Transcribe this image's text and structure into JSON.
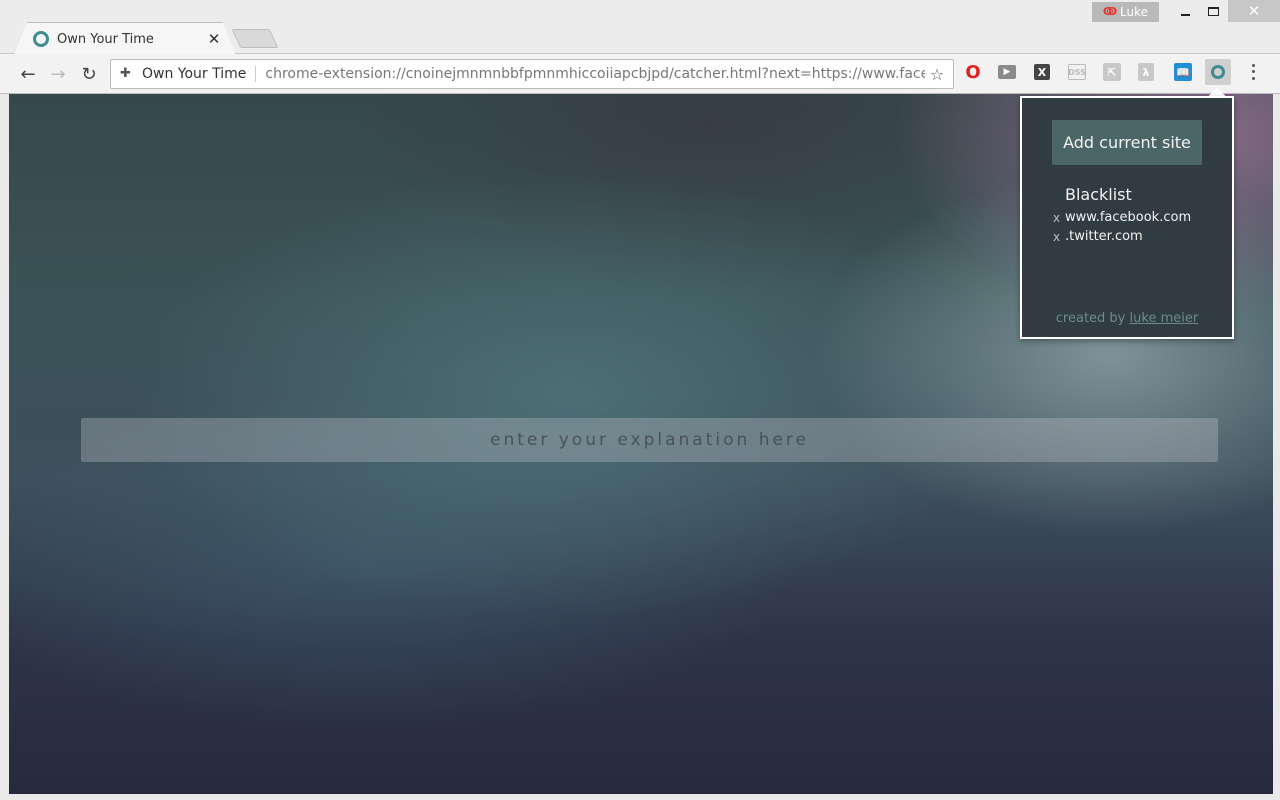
{
  "window": {
    "profile_name": "Luke",
    "close_glyph": "✕"
  },
  "tab": {
    "title": "Own Your Time",
    "close_glyph": "✕"
  },
  "toolbar": {
    "back_glyph": "←",
    "forward_glyph": "→",
    "reload_glyph": "↻",
    "origin_label": "Own Your Time",
    "url": "chrome-extension://cnoinejmnmnbbfpmnmhiccoiiapcbjpd/catcher.html?next=https://www.facebo",
    "star_glyph": "☆"
  },
  "extensions": [
    {
      "name": "opera-icon",
      "glyph": "O"
    },
    {
      "name": "video-icon",
      "glyph": "▶"
    },
    {
      "name": "x-icon",
      "glyph": "X"
    },
    {
      "name": "dss-icon",
      "glyph": "DSS"
    },
    {
      "name": "share-icon",
      "glyph": "⇱"
    },
    {
      "name": "pdf-icon",
      "glyph": "λ"
    },
    {
      "name": "book-icon",
      "glyph": "📖"
    },
    {
      "name": "own-your-time-icon",
      "glyph": ""
    }
  ],
  "page": {
    "input_placeholder": "enter your explanation here"
  },
  "popup": {
    "add_button": "Add current site",
    "blacklist_title": "Blacklist",
    "blacklist": [
      {
        "remove": "x",
        "domain": "www.facebook.com"
      },
      {
        "remove": "x",
        "domain": ".twitter.com"
      }
    ],
    "credit_prefix": "created by",
    "credit_link": "luke meier"
  },
  "colors": {
    "accent": "#3d8c8f",
    "popup_bg": "#303c40",
    "button_bg": "#4b6666"
  }
}
